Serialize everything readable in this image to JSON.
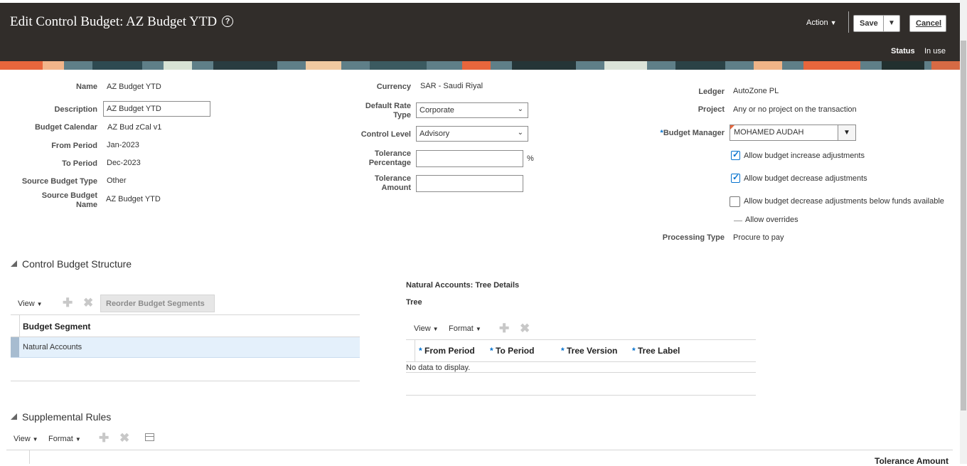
{
  "header": {
    "title": "Edit Control Budget: AZ Budget YTD",
    "action_label": "Action",
    "save_label": "Save",
    "cancel_label": "Cancel",
    "status_label": "Status",
    "status_value": "In use"
  },
  "form_left": {
    "name_label": "Name",
    "name_value": "AZ Budget YTD",
    "description_label": "Description",
    "description_value": "AZ Budget YTD",
    "calendar_label": "Budget Calendar",
    "calendar_value": "AZ Bud zCal v1",
    "from_period_label": "From Period",
    "from_period_value": "Jan-2023",
    "to_period_label": "To Period",
    "to_period_value": "Dec-2023",
    "source_type_label": "Source Budget Type",
    "source_type_value": "Other",
    "source_name_label_1": "Source Budget",
    "source_name_label_2": "Name",
    "source_name_value": "AZ Budget YTD"
  },
  "form_mid": {
    "currency_label": "Currency",
    "currency_value": "SAR - Saudi Riyal",
    "rate_label_1": "Default Rate",
    "rate_label_2": "Type",
    "rate_value": "Corporate",
    "control_level_label": "Control Level",
    "control_level_value": "Advisory",
    "tol_pct_label_1": "Tolerance",
    "tol_pct_label_2": "Percentage",
    "tol_pct_value": "",
    "pct_sign": "%",
    "tol_amt_label_1": "Tolerance",
    "tol_amt_label_2": "Amount",
    "tol_amt_value": ""
  },
  "form_right": {
    "ledger_label": "Ledger",
    "ledger_value": "AutoZone PL",
    "project_label": "Project",
    "project_value": "Any or no project on the transaction",
    "manager_label": "Budget Manager",
    "manager_value": "MOHAMED AUDAH",
    "cb_increase": "Allow budget increase adjustments",
    "cb_decrease": "Allow budget decrease adjustments",
    "cb_below": "Allow budget decrease adjustments below funds available",
    "overrides": "Allow overrides",
    "processing_label": "Processing Type",
    "processing_value": "Procure to pay"
  },
  "structure": {
    "title": "Control Budget Structure",
    "view": "View",
    "reorder": "Reorder Budget Segments",
    "col_header": "Budget Segment",
    "rows": [
      "Natural Accounts"
    ]
  },
  "tree": {
    "title": "Natural Accounts: Tree Details",
    "subtitle": "Tree",
    "view": "View",
    "format": "Format",
    "cols": [
      "From Period",
      "To Period",
      "Tree Version",
      "Tree Label"
    ],
    "empty": "No data to display."
  },
  "supplemental": {
    "title": "Supplemental Rules",
    "view": "View",
    "format": "Format",
    "col_tolerance": "Tolerance Amount"
  }
}
